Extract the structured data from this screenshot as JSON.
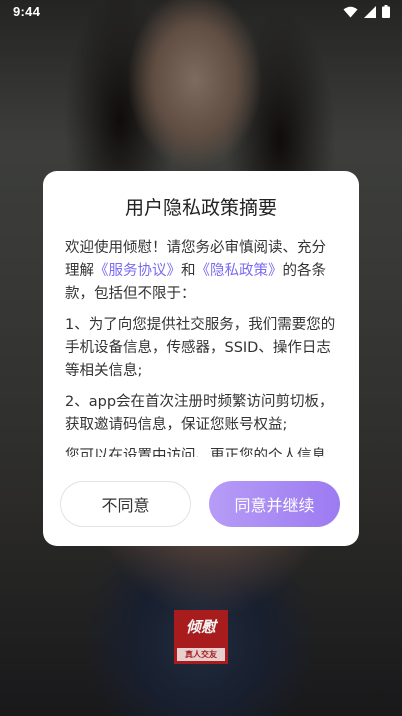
{
  "status_bar": {
    "time": "9:44",
    "icons": [
      "wifi-icon",
      "signal-icon",
      "battery-icon"
    ]
  },
  "logo": {
    "main": "倾慰",
    "sub": "真人交友"
  },
  "dialog": {
    "title": "用户隐私政策摘要",
    "intro_prefix": "欢迎使用倾慰！请您务必审慎阅读、充分理解",
    "service_agreement": "《服务协议》",
    "and": "和",
    "privacy_policy": "《隐私政策》",
    "intro_suffix": "的各条款，包括但不限于：",
    "item1": "1、为了向您提供社交服务，我们需要您的手机设备信息，传感器，SSID、操作日志等相关信息;",
    "item2": "2、app会在首次注册时频繁访问剪切板，获取邀请码信息，保证您账号权益;",
    "item3": "您可以在设置中访问、更正您的个人信息",
    "disagree_label": "不同意",
    "agree_label": "同意并继续"
  },
  "colors": {
    "link": "#7b6cf0",
    "agree_button_start": "#b79cf6",
    "agree_button_end": "#9c7bf1"
  }
}
